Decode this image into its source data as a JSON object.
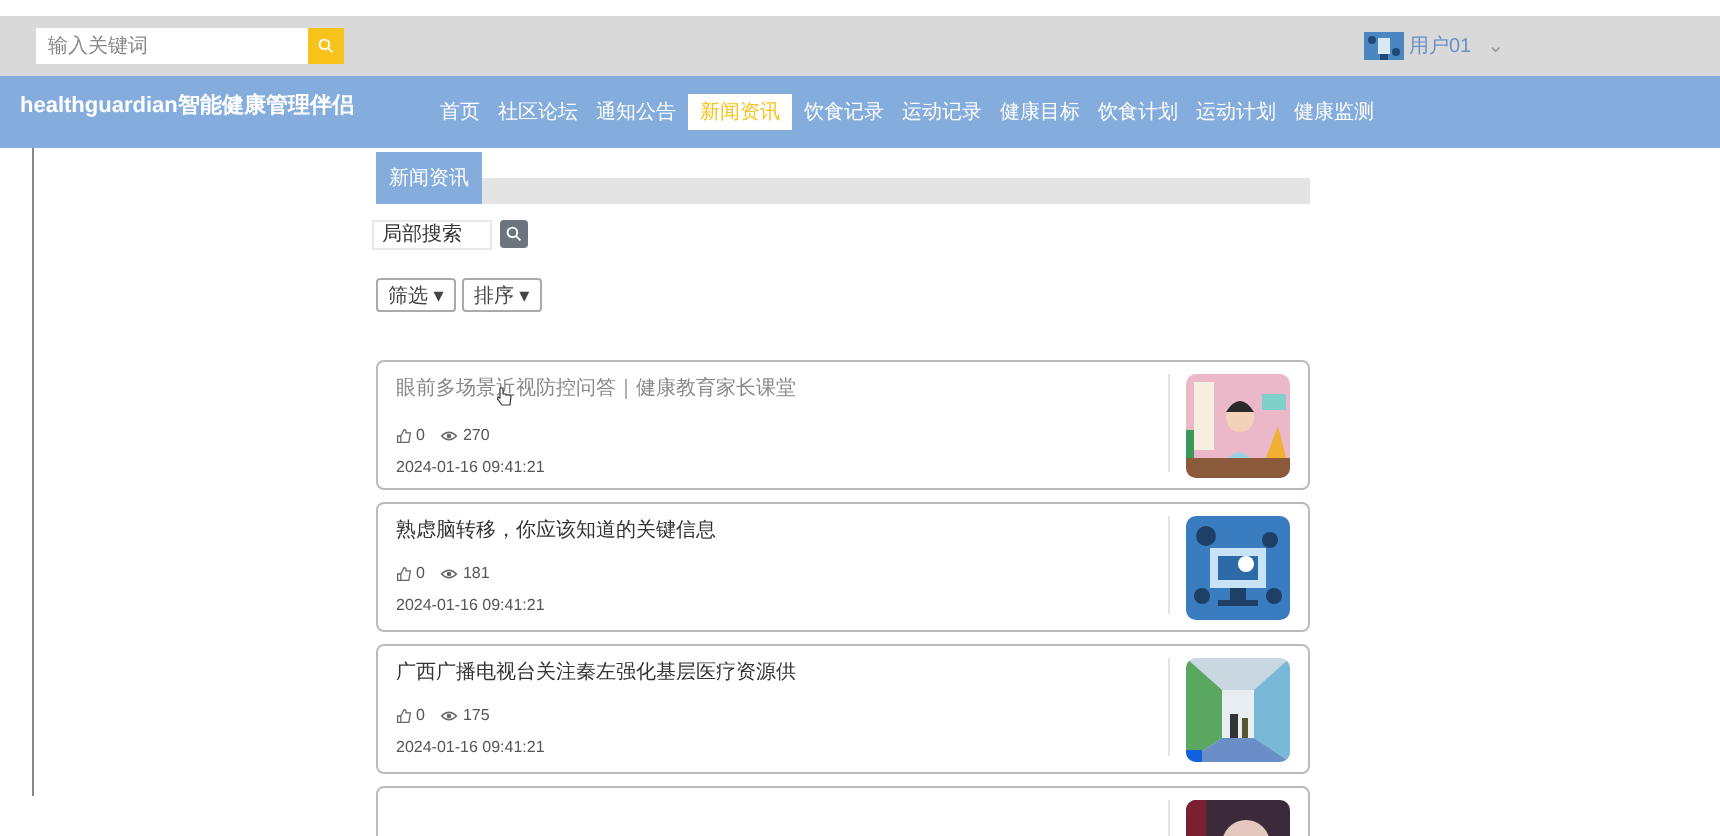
{
  "top_bar": {
    "search": {
      "placeholder": "输入关键词"
    },
    "user": {
      "name": "用户01",
      "menu_caret": "⌄"
    }
  },
  "header": {
    "brand": "healthguardian智能健康管理伴侣",
    "nav": [
      {
        "label": "首页",
        "selected": false
      },
      {
        "label": "社区论坛",
        "selected": false
      },
      {
        "label": "通知公告",
        "selected": false
      },
      {
        "label": "新闻资讯",
        "selected": true
      },
      {
        "label": "饮食记录",
        "selected": false
      },
      {
        "label": "运动记录",
        "selected": false
      },
      {
        "label": "健康目标",
        "selected": false
      },
      {
        "label": "饮食计划",
        "selected": false
      },
      {
        "label": "运动计划",
        "selected": false
      },
      {
        "label": "健康监测",
        "selected": false
      }
    ]
  },
  "section": {
    "tab": "新闻资讯",
    "search": {
      "placeholder": "局部搜索"
    },
    "filters": [
      {
        "label": "筛选",
        "caret": "▾"
      },
      {
        "label": "排序",
        "caret": "▾"
      }
    ]
  },
  "news": [
    {
      "title": "眼前多场景近视防控问答｜健康教育家长课堂",
      "likes": "0",
      "views": "270",
      "date": "2024-01-16 09:41:21",
      "hovered": true
    },
    {
      "title": "熟虑脑转移，你应该知道的关键信息",
      "likes": "0",
      "views": "181",
      "date": "2024-01-16 09:41:21",
      "hovered": false
    },
    {
      "title": "广西广播电视台关注秦左强化基层医疗资源供",
      "likes": "0",
      "views": "175",
      "date": "2024-01-16 09:41:21",
      "hovered": false
    },
    {
      "kind": "picture"
    }
  ]
}
